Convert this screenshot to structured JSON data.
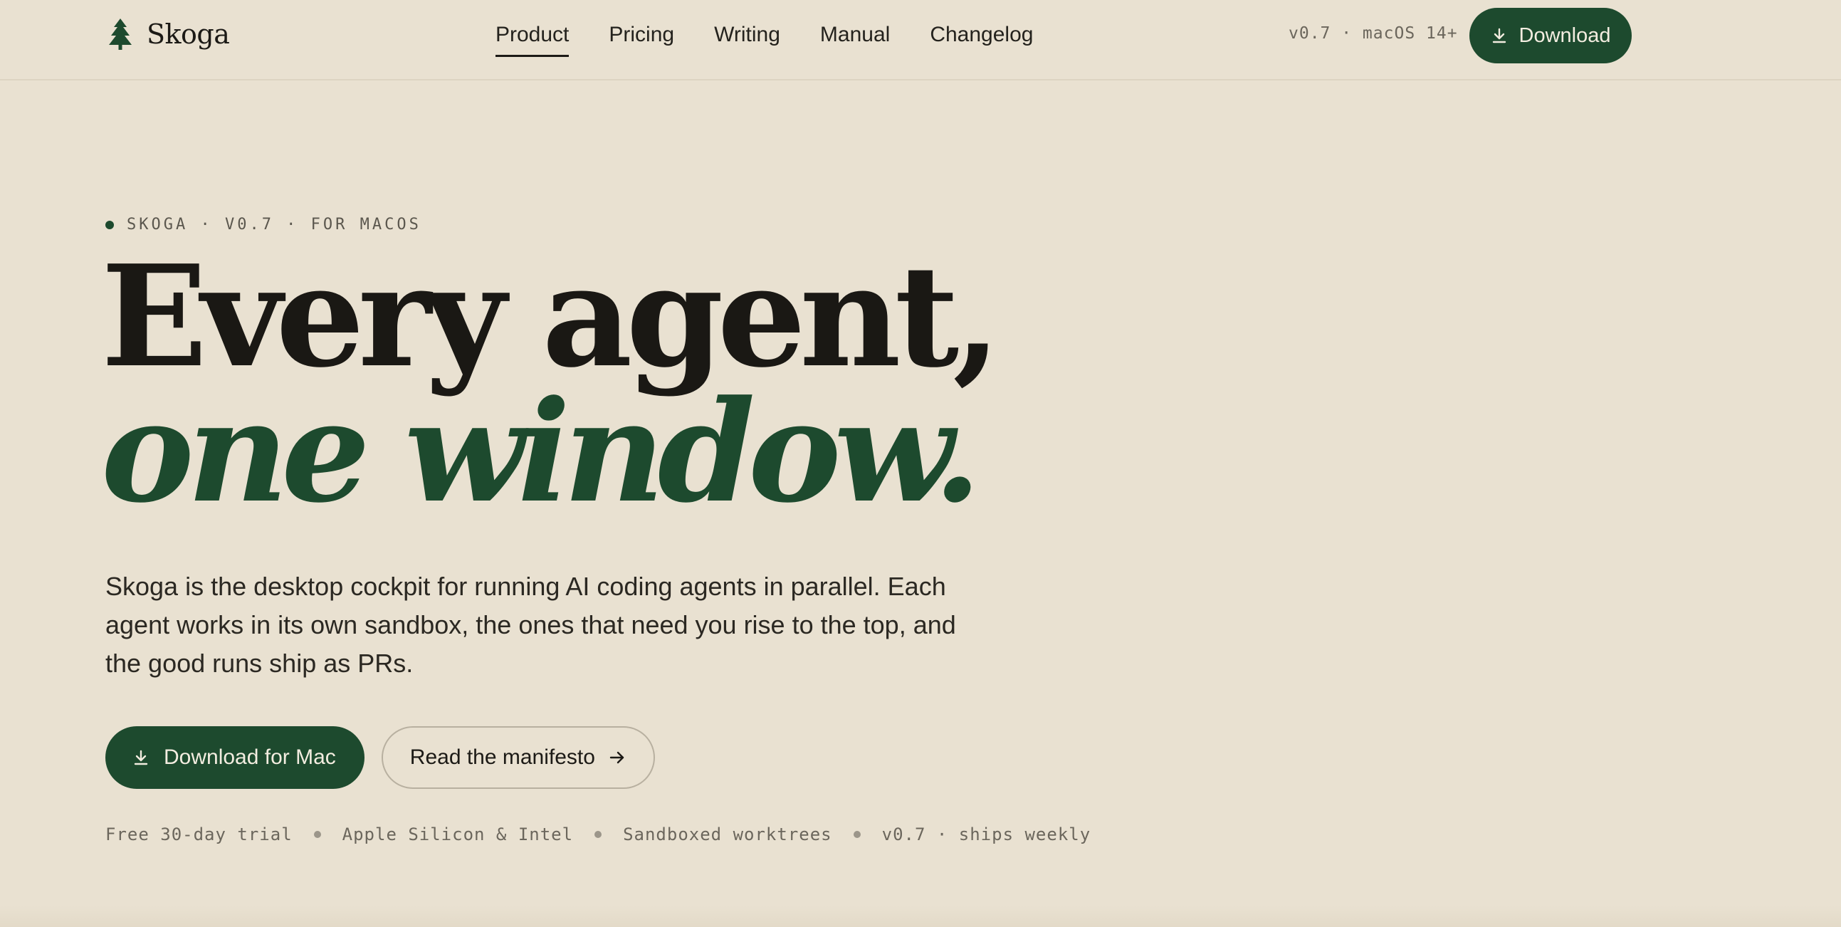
{
  "brand": {
    "name": "Skoga",
    "icon": "pine-tree-icon"
  },
  "nav": {
    "links": [
      {
        "label": "Product",
        "active": true
      },
      {
        "label": "Pricing",
        "active": false
      },
      {
        "label": "Writing",
        "active": false
      },
      {
        "label": "Manual",
        "active": false
      },
      {
        "label": "Changelog",
        "active": false
      }
    ],
    "meta": "v0.7 · macOS 14+",
    "download_label": "Download"
  },
  "hero": {
    "eyebrow": "SKOGA · V0.7 · FOR MACOS",
    "headline_line1": "Every agent,",
    "headline_line2": "one window.",
    "lede": "Skoga is the desktop cockpit for running AI coding agents in parallel. Each agent works in its own sandbox, the ones that need you rise to the top, and the good runs ship as PRs.",
    "primary_cta": "Download for Mac",
    "secondary_cta": "Read the manifesto",
    "features": [
      "Free 30-day trial",
      "Apple Silicon & Intel",
      "Sandboxed worktrees",
      "v0.7 · ships weekly"
    ]
  },
  "colors": {
    "background": "#e9e1d1",
    "accent_green": "#1d4a2e",
    "text_dark": "#1c1a16",
    "muted": "#6b665c"
  },
  "icons": {
    "download": "download-icon",
    "arrow": "arrow-right-icon"
  }
}
